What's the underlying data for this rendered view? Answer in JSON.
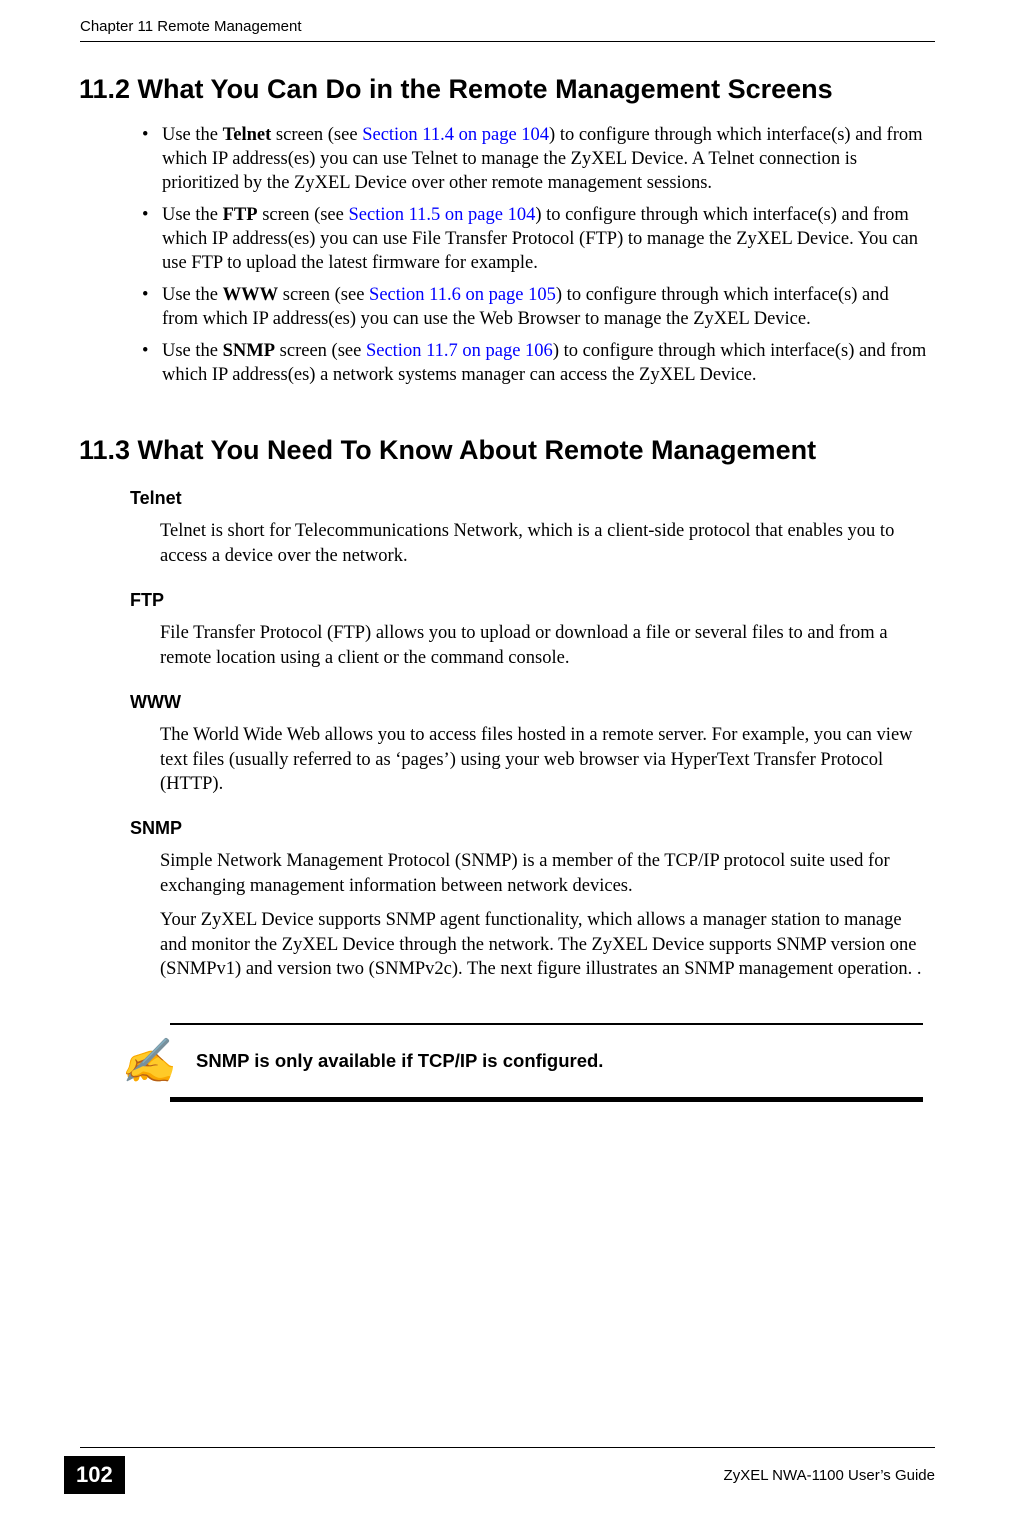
{
  "header": {
    "chapter": "Chapter 11 Remote Management"
  },
  "section_11_2": {
    "title": "11.2  What You Can Do in the Remote Management Screens",
    "items": [
      {
        "pre": "Use the ",
        "bold": "Telnet",
        "mid": " screen (see ",
        "link": "Section 11.4 on page 104",
        "post": ") to configure through which interface(s) and from which IP address(es) you can use Telnet to manage the ZyXEL Device. A Telnet connection is prioritized by the ZyXEL Device over other remote management sessions."
      },
      {
        "pre": "Use the ",
        "bold": "FTP",
        "mid": " screen (see ",
        "link": "Section 11.5 on page 104",
        "post": ") to configure through which interface(s) and from which IP address(es) you can use File Transfer Protocol (FTP) to manage the ZyXEL Device. You can use FTP to upload the latest firmware for example."
      },
      {
        "pre": "Use the ",
        "bold": "WWW",
        "mid": " screen (see ",
        "link": "Section 11.6 on page 105",
        "post": ") to configure through which interface(s) and from which IP address(es) you can use the Web Browser to manage the ZyXEL Device."
      },
      {
        "pre": "Use the ",
        "bold": "SNMP",
        "mid": " screen (see ",
        "link": "Section 11.7 on page 106",
        "post": ") to configure through which interface(s) and from which IP address(es) a network systems manager can access the ZyXEL Device."
      }
    ]
  },
  "section_11_3": {
    "title": "11.3  What You Need To Know About Remote Management",
    "subsections": [
      {
        "head": "Telnet",
        "paras": [
          "Telnet is short for Telecommunications Network, which is a client-side protocol that enables you to access a device over the network."
        ]
      },
      {
        "head": "FTP",
        "paras": [
          "File Transfer Protocol (FTP) allows you to upload or download a file or several files to and from a remote location using a client or the command console."
        ]
      },
      {
        "head": "WWW",
        "paras": [
          "The World Wide Web allows you to access files hosted in a remote server. For example, you can view text files (usually referred to as ‘pages’) using your web browser via HyperText Transfer Protocol (HTTP)."
        ]
      },
      {
        "head": "SNMP",
        "paras": [
          "Simple Network Management Protocol (SNMP) is a member of the TCP/IP protocol suite used for exchanging management information between network devices.",
          "Your ZyXEL Device supports SNMP agent functionality, which allows a manager station to manage and monitor the ZyXEL Device through the network. The ZyXEL Device supports SNMP version one (SNMPv1) and version two (SNMPv2c). The next figure illustrates an SNMP management operation. ."
        ]
      }
    ]
  },
  "note": {
    "icon": "✍",
    "text": "SNMP is only available if TCP/IP is configured."
  },
  "footer": {
    "page": "102",
    "guide": "ZyXEL NWA-1100 User’s Guide"
  }
}
